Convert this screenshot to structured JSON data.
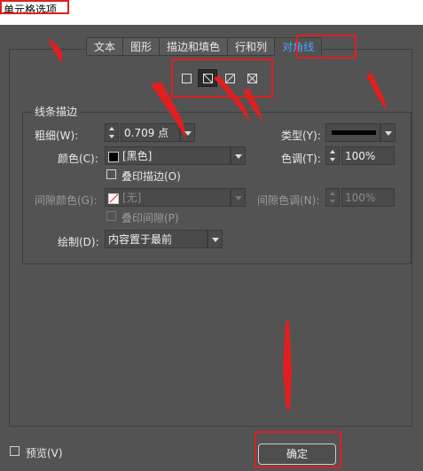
{
  "window": {
    "title": "单元格选项"
  },
  "tabs": [
    {
      "label": "文本",
      "active": false
    },
    {
      "label": "图形",
      "active": false
    },
    {
      "label": "描边和填色",
      "active": false
    },
    {
      "label": "行和列",
      "active": false
    },
    {
      "label": "对角线",
      "active": true
    }
  ],
  "diagonal_buttons": [
    {
      "icon": "no-diagonal-icon",
      "selected": false
    },
    {
      "icon": "top-left-to-bottom-right-icon",
      "selected": true
    },
    {
      "icon": "bottom-left-to-top-right-icon",
      "selected": false
    },
    {
      "icon": "cross-diagonal-icon",
      "selected": false
    }
  ],
  "line_stroke": {
    "group_title": "线条描边",
    "weight_label": "粗细(W):",
    "weight_value": "0.709 点",
    "type_label": "类型(Y):",
    "color_label": "颜色(C):",
    "color_value": "[黑色]",
    "tint_label": "色调(T):",
    "tint_value": "100%",
    "overprint_stroke_label": "叠印描边(O)",
    "gap_color_label": "间隙颜色(G):",
    "gap_color_value": "[无]",
    "gap_tint_label": "间隙色调(N):",
    "gap_tint_value": "100%",
    "overprint_gap_label": "叠印间隙(P)",
    "draw_label": "绘制(D):",
    "draw_value": "内容置于最前"
  },
  "footer": {
    "preview_label": "预览(V)",
    "ok_label": "确定"
  },
  "colors": {
    "annotation_red": "#e02020",
    "active_tab_blue": "#4aa3ff",
    "dialog_bg": "#535353"
  }
}
